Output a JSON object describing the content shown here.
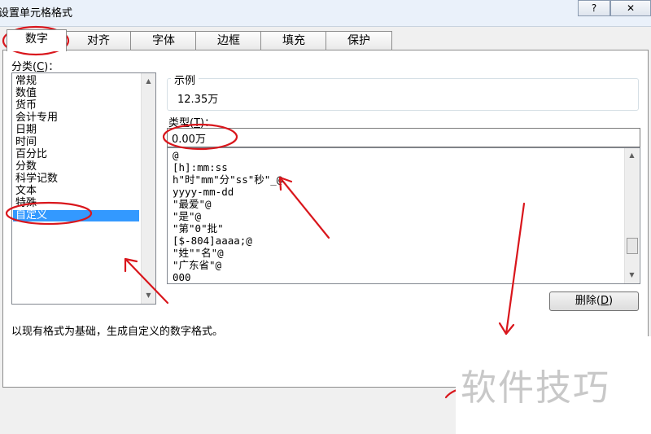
{
  "window": {
    "title": "设置单元格格式",
    "help_label": "?",
    "close_label": "✕"
  },
  "tabs": [
    {
      "label": "数字"
    },
    {
      "label": "对齐"
    },
    {
      "label": "字体"
    },
    {
      "label": "边框"
    },
    {
      "label": "填充"
    },
    {
      "label": "保护"
    }
  ],
  "category": {
    "label_prefix": "分类(",
    "label_key": "C",
    "label_suffix": ")：",
    "items": [
      "常规",
      "数值",
      "货币",
      "会计专用",
      "日期",
      "时间",
      "百分比",
      "分数",
      "科学记数",
      "文本",
      "特殊",
      "自定义"
    ],
    "selected": "自定义"
  },
  "sample": {
    "legend": "示例",
    "value": "12.35万"
  },
  "type": {
    "label_prefix": "类型(",
    "label_key": "T",
    "label_suffix": ")：",
    "value": "0.00万"
  },
  "formats": [
    "@",
    "[h]:mm:ss",
    "h\"时\"mm\"分\"ss\"秒\"_@",
    "yyyy-mm-dd",
    "\"最爱\"@",
    "\"是\"@",
    "\"第\"0\"批\"",
    "[$-804]aaaa;@",
    "\"姓\"\"名\"@",
    "\"广东省\"@",
    "000"
  ],
  "delete_button": {
    "label_prefix": "删除(",
    "label_key": "D",
    "label_suffix": ")"
  },
  "description": "以现有格式为基础，生成自定义的数字格式。",
  "watermark": "软件技巧",
  "colors": {
    "selection": "#3399ff",
    "annotation": "#d9161c"
  }
}
